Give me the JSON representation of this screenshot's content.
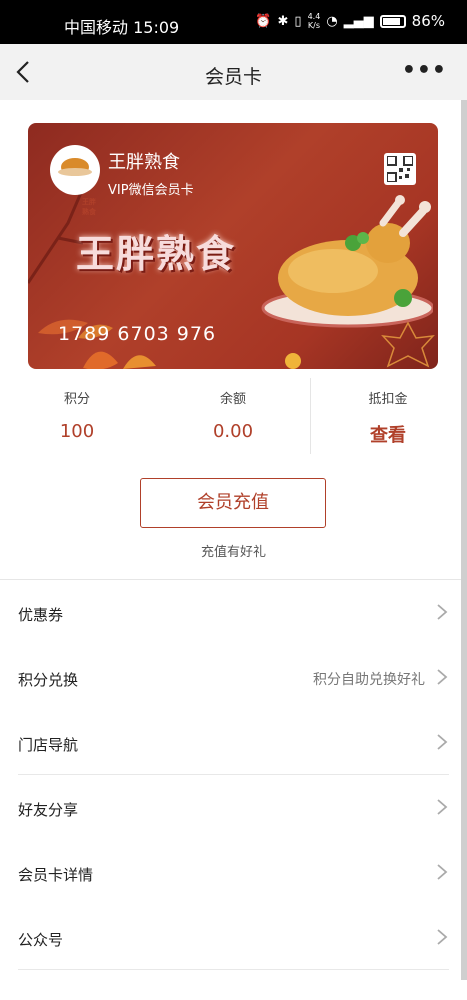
{
  "status_bar": {
    "carrier": "中国移动",
    "time": "15:09",
    "speed_top": "4.4",
    "speed_unit": "K/s",
    "battery": "86%",
    "battery_level": 0.86
  },
  "nav": {
    "title": "会员卡",
    "more": "•••"
  },
  "card": {
    "logo_text": "王胖熟食",
    "store_name": "王胖熟食",
    "subtitle": "VIP微信会员卡",
    "big_title": "王胖熟食",
    "card_number": "1789 6703 976"
  },
  "stats": [
    {
      "label": "积分",
      "value": "100"
    },
    {
      "label": "余额",
      "value": "0.00"
    },
    {
      "label": "抵扣金",
      "value": "查看"
    }
  ],
  "recharge": {
    "button_label": "会员充值",
    "note": "充值有好礼"
  },
  "menu": [
    {
      "label": "优惠券",
      "extra": ""
    },
    {
      "label": "积分兑换",
      "extra": "积分自助兑换好礼"
    },
    {
      "label": "门店导航",
      "extra": ""
    },
    {
      "label": "好友分享",
      "extra": ""
    },
    {
      "label": "会员卡详情",
      "extra": ""
    },
    {
      "label": "公众号",
      "extra": ""
    }
  ],
  "colors": {
    "accent": "#b0402a",
    "card_bg": "#a63524",
    "nav_bg": "#f2f2f2"
  }
}
